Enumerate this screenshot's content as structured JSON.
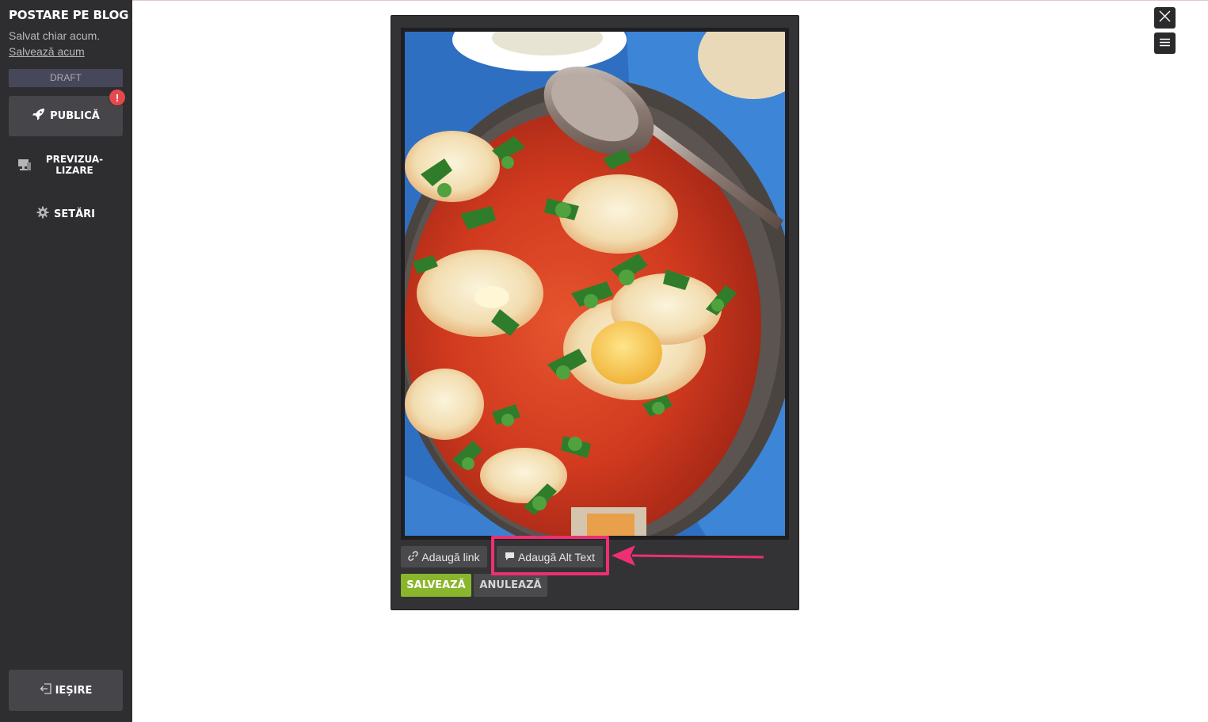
{
  "sidebar": {
    "title": "POSTARE PE BLOG",
    "saved_status": "Salvat chiar acum.",
    "save_now": "Salvează acum",
    "draft_label": "DRAFT",
    "publish_label": "PUBLICĂ",
    "publish_badge": "!",
    "preview_label": "PREVIZUA-\nLIZARE",
    "preview_line1": "PREVIZUA-",
    "preview_line2": "LIZARE",
    "settings_label": "SETĂRI",
    "exit_label": "IEȘIRE"
  },
  "editor": {
    "add_link_label": "Adaugă link",
    "add_alt_text_label": "Adaugă Alt Text",
    "save_label": "SALVEAZĂ",
    "cancel_label": "ANULEAZĂ"
  },
  "colors": {
    "sidebar_bg": "#2e2e30",
    "accent_green": "#89b62c",
    "highlight": "#ee2f74",
    "badge_red": "#e5484d"
  },
  "icons": {
    "publish": "rocket-icon",
    "preview": "monitor-icon",
    "settings": "gear-icon",
    "exit": "exit-icon",
    "close": "close-icon",
    "menu": "hamburger-menu-icon",
    "link": "link-icon",
    "alt_text": "comment-icon"
  }
}
